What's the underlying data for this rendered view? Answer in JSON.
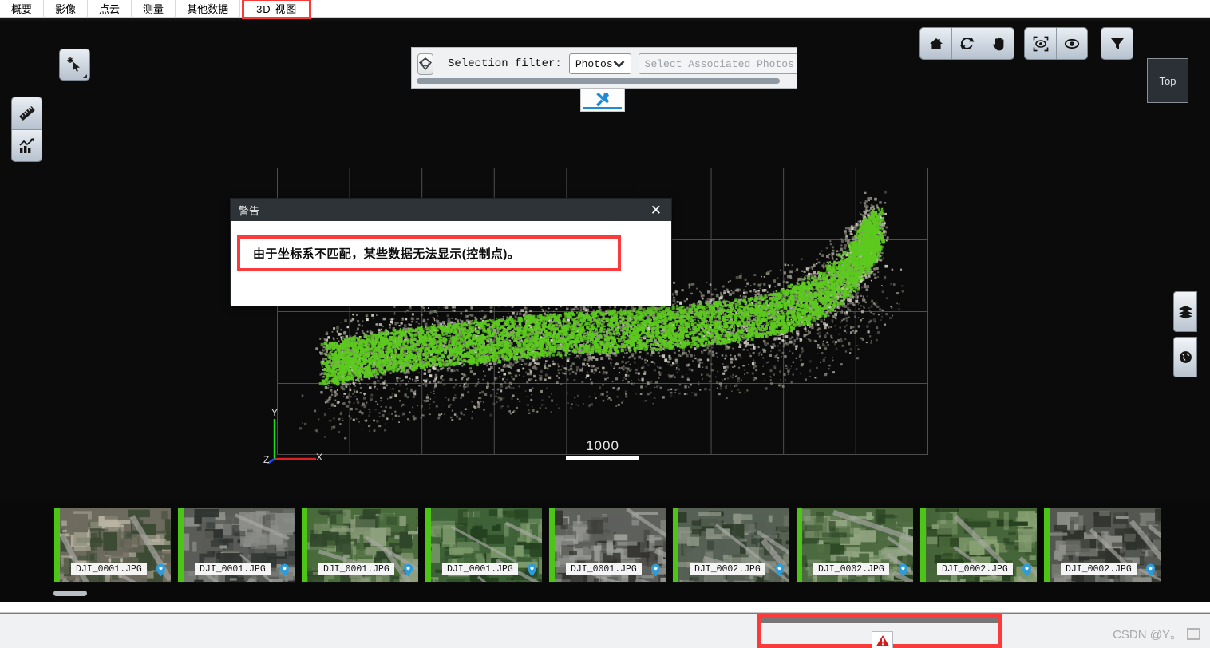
{
  "tabs": [
    {
      "label": "概要",
      "active": false
    },
    {
      "label": "影像",
      "active": false
    },
    {
      "label": "点云",
      "active": false
    },
    {
      "label": "测量",
      "active": false
    },
    {
      "label": "其他数据",
      "active": false
    },
    {
      "label": "3D 视图",
      "active": true
    }
  ],
  "selection_panel": {
    "lasso_icon": "polygon-select-icon",
    "filter_label": "Selection filter:",
    "filter_value": "Photos",
    "filter_options": [
      "Photos"
    ],
    "associated_placeholder": "Select Associated Photos",
    "associated_value": "",
    "tools_icon": "tools-icon"
  },
  "left_tools": [
    {
      "name": "select-tool",
      "icon": "cursor-select-icon"
    },
    {
      "name": "measure-tool",
      "icon": "ruler-icon"
    },
    {
      "name": "analysis-tool",
      "icon": "chart-icon"
    }
  ],
  "nav_tools": [
    {
      "name": "home-view",
      "icon": "home-icon"
    },
    {
      "name": "rotate-view",
      "icon": "rotate-icon"
    },
    {
      "name": "pan-view",
      "icon": "hand-icon"
    },
    {
      "name": "fit-view",
      "icon": "fit-target-icon"
    },
    {
      "name": "visibility",
      "icon": "eye-icon"
    },
    {
      "name": "filter",
      "icon": "funnel-icon"
    }
  ],
  "view_cube": {
    "label": "Top"
  },
  "edge_tools": [
    {
      "name": "layers-panel",
      "icon": "layers-icon"
    },
    {
      "name": "globe-panel",
      "icon": "globe-icon"
    }
  ],
  "viewport": {
    "scale_value": "1000",
    "axis": {
      "x": "X",
      "y": "Y",
      "z": "Z"
    },
    "axis_colors": {
      "x": "#e02020",
      "y": "#19e019",
      "z": "#2050ff"
    },
    "point_cloud_color": "#5cc91e",
    "background": "#0b0b0b",
    "grid_color": "#5a5a5a"
  },
  "dialog": {
    "title": "警告",
    "close_label": "✕",
    "message": "由于坐标系不匹配，某些数据无法显示(控制点)。",
    "highlight_color": "#fa3b3b"
  },
  "filmstrip": {
    "thumbnails": [
      {
        "filename": "DJI_0001.JPG",
        "pin": "map-pin-icon",
        "c1": "#6d6a5e",
        "c2": "#b9b3a2",
        "c3": "#3c4a33"
      },
      {
        "filename": "DJI_0001.JPG",
        "pin": "map-pin-icon",
        "c1": "#5a5c58",
        "c2": "#8d8f8a",
        "c3": "#2e3330"
      },
      {
        "filename": "DJI_0001.JPG",
        "pin": "map-pin-icon",
        "c1": "#4a6b3c",
        "c2": "#8fa07e",
        "c3": "#30462a"
      },
      {
        "filename": "DJI_0001.JPG",
        "pin": "map-pin-icon",
        "c1": "#3f6238",
        "c2": "#7d9a6c",
        "c3": "#24411f"
      },
      {
        "filename": "DJI_0001.JPG",
        "pin": "map-pin-icon",
        "c1": "#5e605c",
        "c2": "#9a9c97",
        "c3": "#34332f"
      },
      {
        "filename": "DJI_0002.JPG",
        "pin": "map-pin-icon",
        "c1": "#566054",
        "c2": "#8b9384",
        "c3": "#2c3a28"
      },
      {
        "filename": "DJI_0002.JPG",
        "pin": "map-pin-icon",
        "c1": "#4d6a40",
        "c2": "#91a481",
        "c3": "#2a4423"
      },
      {
        "filename": "DJI_0002.JPG",
        "pin": "map-pin-icon",
        "c1": "#466539",
        "c2": "#86a072",
        "c3": "#27401f"
      },
      {
        "filename": "DJI_0002.JPG",
        "pin": "map-pin-icon",
        "c1": "#545751",
        "c2": "#8e9089",
        "c3": "#2f322c"
      }
    ]
  },
  "status": {
    "warning_icon": "warning-triangle-icon",
    "highlight_color": "#fa3b3b"
  },
  "watermark": {
    "text": "CSDN @Y。",
    "icon": "watermark-icon"
  }
}
